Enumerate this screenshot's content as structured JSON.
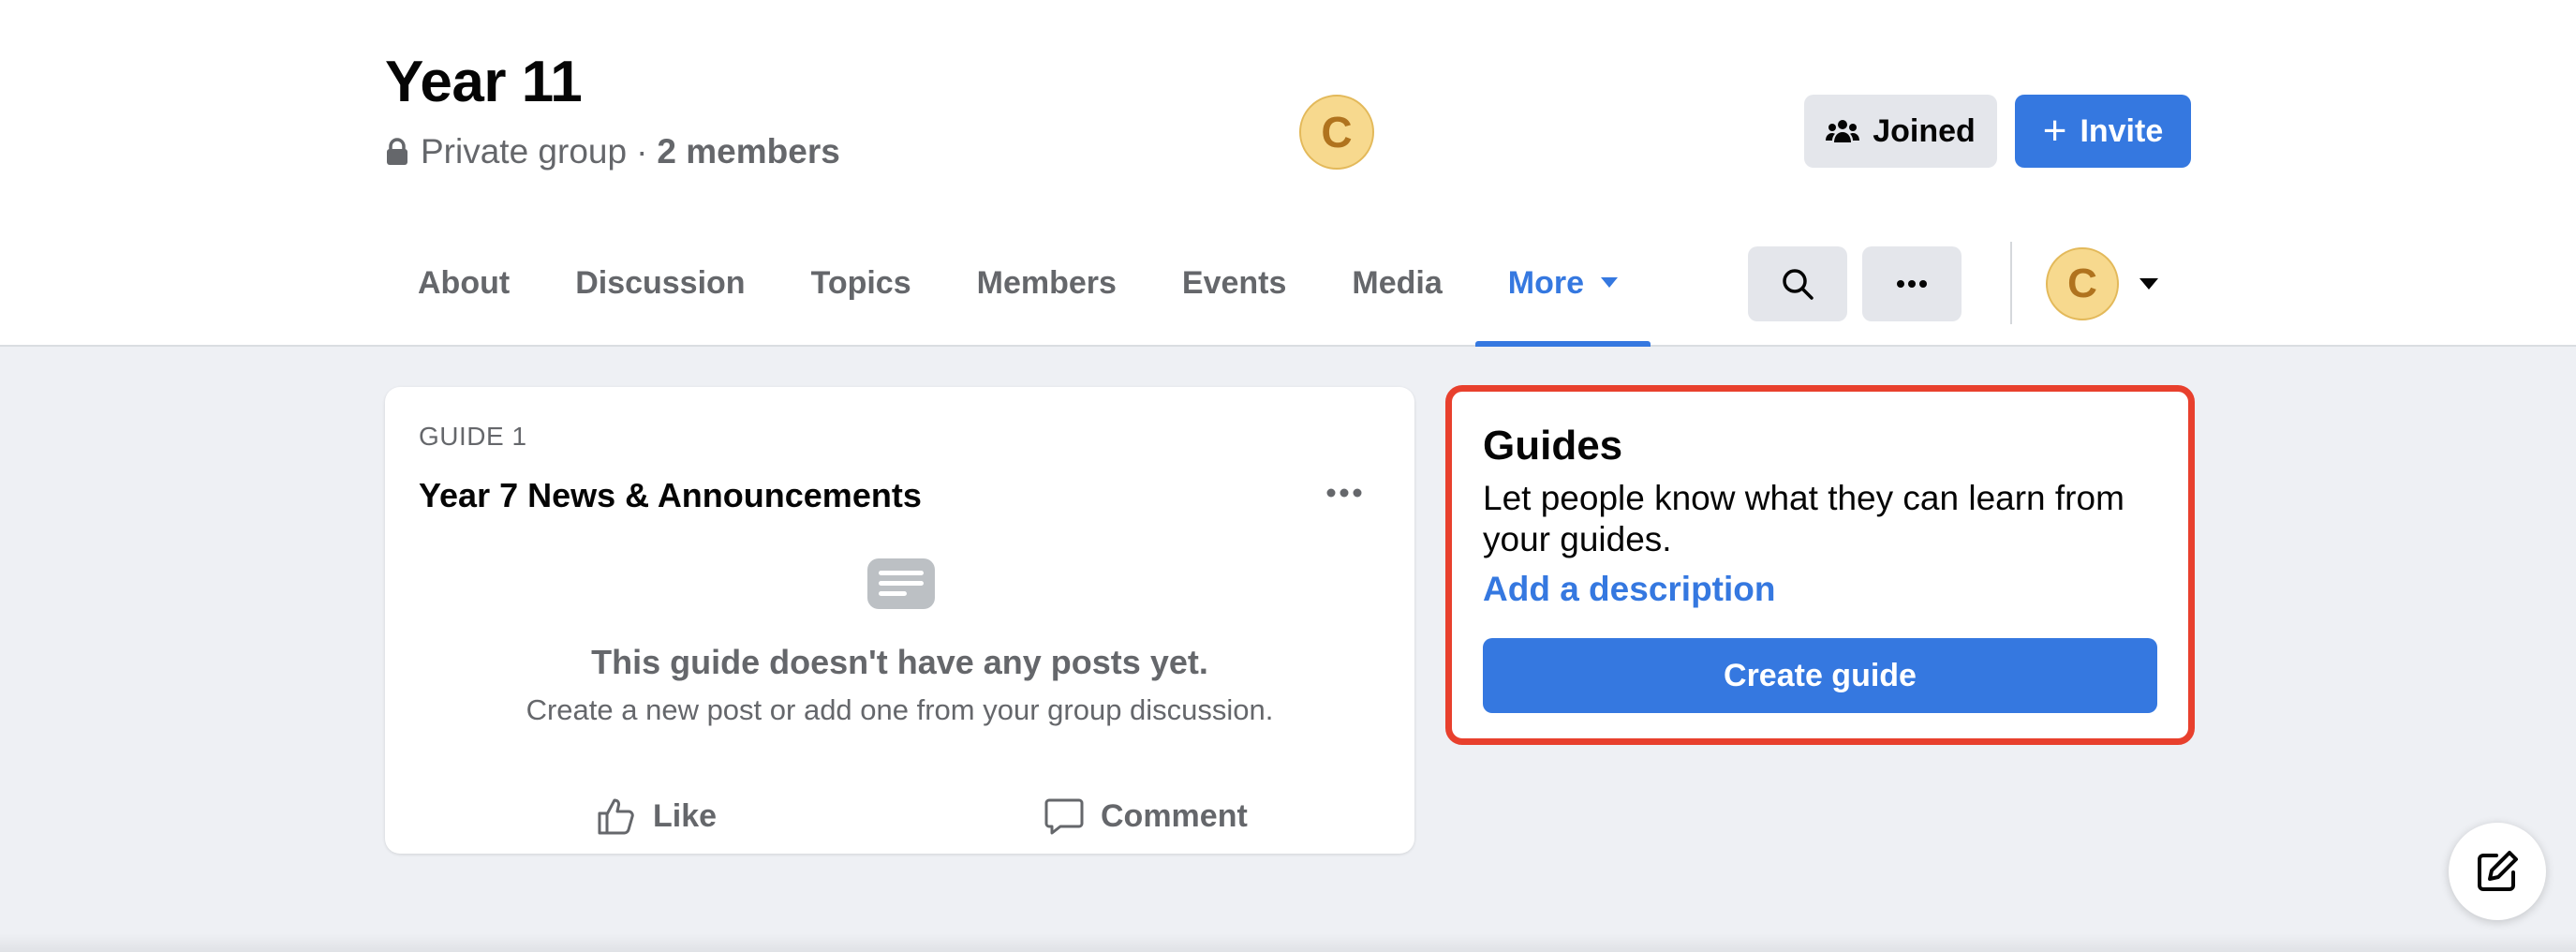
{
  "group": {
    "title": "Year 11",
    "privacy": "Private group",
    "separator": "·",
    "members": "2 members",
    "avatar_initial": "C"
  },
  "header_buttons": {
    "joined_label": "Joined",
    "invite_label": "Invite"
  },
  "tabs": [
    {
      "label": "About"
    },
    {
      "label": "Discussion"
    },
    {
      "label": "Topics"
    },
    {
      "label": "Members"
    },
    {
      "label": "Events"
    },
    {
      "label": "Media"
    },
    {
      "label": "More",
      "active": true
    }
  ],
  "nav": {
    "avatar_initial": "C"
  },
  "guide_card": {
    "label": "GUIDE 1",
    "title": "Year 7 News & Announcements",
    "empty_title": "This guide doesn't have any posts yet.",
    "empty_subtitle": "Create a new post or add one from your group discussion.",
    "like_label": "Like",
    "comment_label": "Comment"
  },
  "guides_panel": {
    "heading": "Guides",
    "description": "Let people know what they can learn from your guides.",
    "link": "Add a description",
    "button": "Create guide"
  },
  "colors": {
    "accent": "#3578e0",
    "highlight_border": "#e8402d",
    "avatar_bg": "#f7d98e",
    "page_bg": "#eef0f4"
  },
  "icons": [
    "lock-icon",
    "people-icon",
    "plus-icon",
    "caret-down-icon",
    "search-icon",
    "ellipsis-icon",
    "document-icon",
    "like-icon",
    "comment-icon",
    "compose-icon"
  ]
}
